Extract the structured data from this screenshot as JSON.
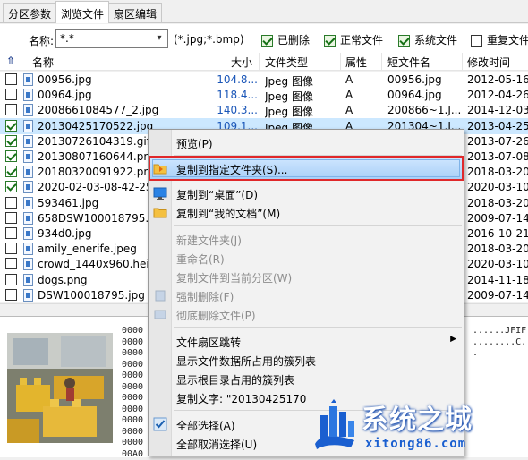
{
  "tabs": [
    {
      "label": "分区参数"
    },
    {
      "label": "浏览文件"
    },
    {
      "label": "扇区编辑"
    }
  ],
  "filter": {
    "name_label": "名称:",
    "name_value": "*.*",
    "hint": "(*.jpg;*.bmp)",
    "checkboxes": [
      {
        "label": "已删除",
        "checked": true
      },
      {
        "label": "正常文件",
        "checked": true
      },
      {
        "label": "系统文件",
        "checked": true
      },
      {
        "label": "重复文件",
        "checked": false
      }
    ]
  },
  "columns": {
    "up": "⇧",
    "name": "名称",
    "size": "大小",
    "type": "文件类型",
    "attr": "属性",
    "short": "短文件名",
    "mtime": "修改时间"
  },
  "files": [
    {
      "checked": false,
      "name": "00956.jpg",
      "size": "104.8...",
      "type": "Jpeg 图像",
      "attr": "A",
      "short": "00956.jpg",
      "mtime": "2012-05-16"
    },
    {
      "checked": false,
      "name": "00964.jpg",
      "size": "118.4...",
      "type": "Jpeg 图像",
      "attr": "A",
      "short": "00964.jpg",
      "mtime": "2012-04-26"
    },
    {
      "checked": false,
      "name": "2008661084577_2.jpg",
      "size": "140.3...",
      "type": "Jpeg 图像",
      "attr": "A",
      "short": "200866~1.J...",
      "mtime": "2014-12-03"
    },
    {
      "checked": true,
      "name": "20130425170522.jpg",
      "size": "109.1...",
      "type": "Jpeg 图像",
      "attr": "A",
      "short": "201304~1.J...",
      "mtime": "2013-04-25"
    },
    {
      "checked": true,
      "name": "20130726104319.gif",
      "size": "",
      "type": "",
      "attr": "",
      "short": "",
      "mtime": "2013-07-26"
    },
    {
      "checked": true,
      "name": "20130807160644.png",
      "size": "",
      "type": "",
      "attr": "",
      "short": "",
      "mtime": "2013-07-08"
    },
    {
      "checked": true,
      "name": "20180320091922.png",
      "size": "",
      "type": "",
      "attr": "",
      "short": "",
      "mtime": "2018-03-20"
    },
    {
      "checked": true,
      "name": "2020-02-03-08-42-25",
      "size": "",
      "type": "",
      "attr": "",
      "short": "",
      "mtime": "2020-03-10"
    },
    {
      "checked": false,
      "name": "593461.jpg",
      "size": "",
      "type": "",
      "attr": "",
      "short": "",
      "mtime": "2018-03-20"
    },
    {
      "checked": false,
      "name": "658DSW100018795.jpg",
      "size": "",
      "type": "",
      "attr": "",
      "short": "",
      "mtime": "2009-07-14"
    },
    {
      "checked": false,
      "name": "934d0.jpg",
      "size": "",
      "type": "",
      "attr": "",
      "short": "",
      "mtime": "2016-10-21"
    },
    {
      "checked": false,
      "name": "amily_enerife.jpeg",
      "size": "",
      "type": "",
      "attr": "",
      "short": "",
      "mtime": "2018-03-20"
    },
    {
      "checked": false,
      "name": "crowd_1440x960.heic",
      "size": "",
      "type": "",
      "attr": "",
      "short": "",
      "mtime": "2020-03-10"
    },
    {
      "checked": false,
      "name": "dogs.png",
      "size": "",
      "type": "",
      "attr": "",
      "short": "",
      "mtime": "2014-11-18"
    },
    {
      "checked": false,
      "name": "DSW100018795.jpg",
      "size": "",
      "type": "",
      "attr": "",
      "short": "",
      "mtime": "2009-07-14"
    }
  ],
  "hex": {
    "offsets": [
      "0000",
      "0000",
      "0000",
      "0000",
      "0000",
      "0000",
      "0000",
      "0000",
      "0000",
      "0000",
      "0000",
      "00A0"
    ],
    "ascii": [
      "......JFIF",
      "........C.",
      ".",
      "",
      "",
      "",
      "",
      "",
      "",
      "",
      "",
      ""
    ]
  },
  "context_menu": {
    "items": [
      {
        "label": "预览(P)",
        "disabled": false,
        "icon": "",
        "submenu": false
      },
      {
        "sep": true
      },
      {
        "label": "复制到指定文件夹(S)...",
        "disabled": false,
        "icon": "copy-to-folder-icon",
        "submenu": false,
        "highlighted": true
      },
      {
        "label": "复制到“桌面”(D)",
        "disabled": false,
        "icon": "desktop-icon",
        "submenu": false
      },
      {
        "label": "复制到“我的文档”(M)",
        "disabled": false,
        "icon": "documents-folder-icon",
        "submenu": false
      },
      {
        "sep": true
      },
      {
        "label": "新建文件夹(J)",
        "disabled": true,
        "icon": "",
        "submenu": false
      },
      {
        "label": "重命名(R)",
        "disabled": true,
        "icon": "",
        "submenu": false
      },
      {
        "label": "复制文件到当前分区(W)",
        "disabled": true,
        "icon": "",
        "submenu": false
      },
      {
        "label": "强制删除(F)",
        "disabled": true,
        "icon": "delete-icon",
        "submenu": false
      },
      {
        "label": "彻底删除文件(P)",
        "disabled": true,
        "icon": "wipe-icon",
        "submenu": false
      },
      {
        "sep": true
      },
      {
        "label": "文件扇区跳转",
        "disabled": false,
        "icon": "",
        "submenu": true
      },
      {
        "label": "显示文件数据所占用的簇列表",
        "disabled": false,
        "icon": "",
        "submenu": false
      },
      {
        "label": "显示根目录占用的簇列表",
        "disabled": false,
        "icon": "",
        "submenu": false
      },
      {
        "label": "复制文字: \"20130425170",
        "disabled": false,
        "icon": "",
        "submenu": false
      },
      {
        "sep": true
      },
      {
        "label": "全部选择(A)",
        "disabled": false,
        "icon": "check-all-icon",
        "submenu": false
      },
      {
        "label": "全部取消选择(U)",
        "disabled": false,
        "icon": "",
        "submenu": false
      }
    ]
  },
  "watermark": {
    "title": "系统之城",
    "url": "xitong86.com",
    "brand_color": "#1a5fd0"
  }
}
